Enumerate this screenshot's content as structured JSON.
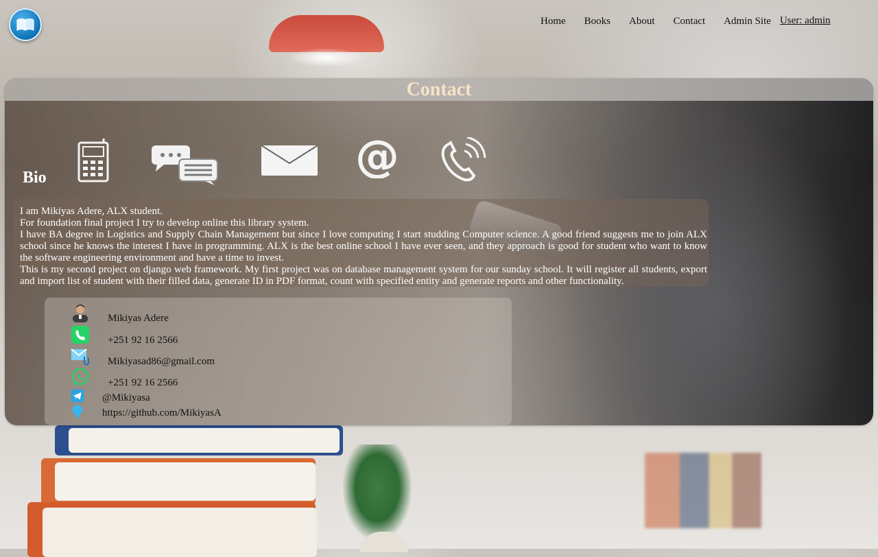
{
  "nav": {
    "logo_icon": "book-icon",
    "links": [
      "Home",
      "Books",
      "About",
      "Contact",
      "Admin Site"
    ],
    "user": "User: admin"
  },
  "page": {
    "title": "Contact",
    "bio_heading": "Bio",
    "bio_icons": [
      "mobile-phone-icon",
      "chat-bubbles-icon",
      "envelope-icon",
      "at-sign-icon",
      "phone-ringing-icon"
    ],
    "bio": [
      "I am Mikiyas Adere, ALX student.",
      "For foundation final project I try to develop online this library system.",
      "I have BA degree in Logistics and Supply Chain Management but since I love computing I start studding Computer science. A good friend suggests me to join ALX school since he knows the interest I have in programming. ALX is the best online school I have ever seen, and they approach is good for student who want to know the software engineering environment and have a time to invest.",
      "This is my second project on django web framework. My first project was on database management system for our sunday school. It will register all students, export and import list of student with their filled data, generate ID in PDF format, count with specified entity and generate reports and other functionality."
    ]
  },
  "contact": {
    "name": "Mikiyas Adere",
    "phone": "+251 92 16 2566",
    "email": "Mikiyasad86@gmail.com",
    "whatsapp": "+251 92 16 2566",
    "telegram": "@Mikiyasa",
    "github": "https://github.com/MikiyasA"
  },
  "colors": {
    "title": "#f7e3c8",
    "logo_blue": "#0a6db3",
    "phone_green": "#25d366",
    "telegram_blue": "#2aa3e0"
  }
}
